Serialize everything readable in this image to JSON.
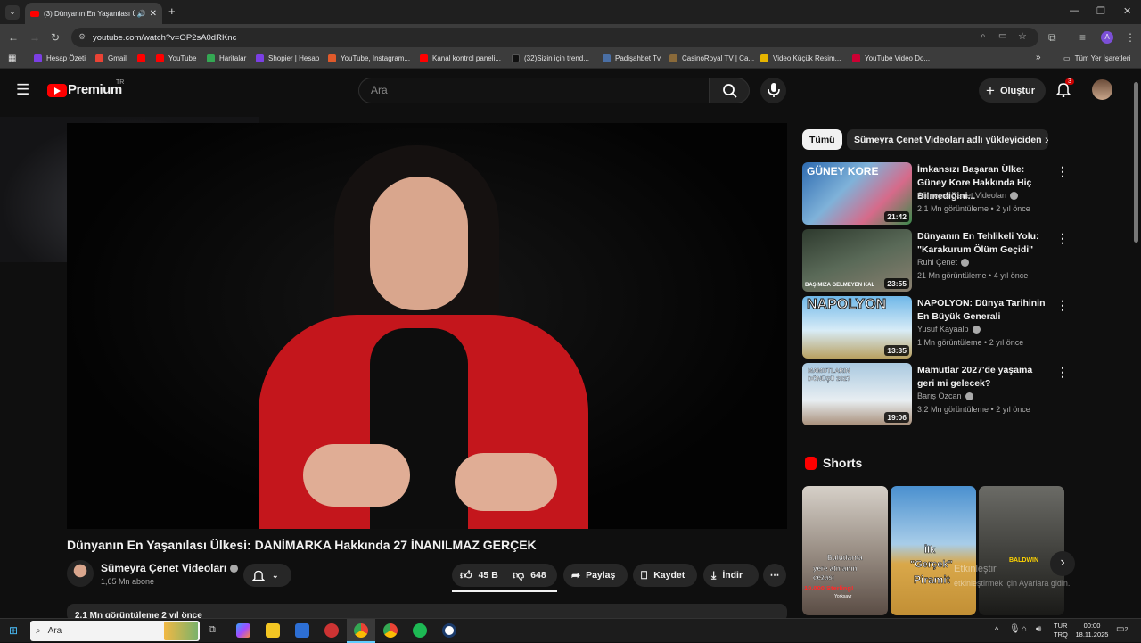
{
  "browser": {
    "tab_title": "(3) Dünyanın En Yaşanılası Ü",
    "url": "youtube.com/watch?v=OP2sA0dRKnc",
    "bookmarks": [
      {
        "label": "Hesap Özeti",
        "color": "#7b3fe4"
      },
      {
        "label": "Gmail",
        "color": "#ea4335"
      },
      {
        "label": "",
        "color": "#ff0000"
      },
      {
        "label": "YouTube",
        "color": "#ff0000"
      },
      {
        "label": "Haritalar",
        "color": "#34a853"
      },
      {
        "label": "Shopier | Hesap",
        "color": "#7b3fe4"
      },
      {
        "label": "YouTube, Instagram...",
        "color": "#e05a2b"
      },
      {
        "label": "Kanal kontrol paneli...",
        "color": "#ff0000"
      },
      {
        "label": "(32)Sizin için trend...",
        "color": "#111111"
      },
      {
        "label": "Padişahbet Tv",
        "color": "#4a6fa5"
      },
      {
        "label": "CasinoRoyal TV | Ca...",
        "color": "#8a6a3a"
      },
      {
        "label": "Video Küçük Resim...",
        "color": "#e5b400"
      },
      {
        "label": "YouTube Video Do...",
        "color": "#cc0033"
      }
    ],
    "all_bookmarks": "Tüm Yer İşaretleri"
  },
  "youtube": {
    "logo_text": "Premium",
    "logo_sup": "TR",
    "search_placeholder": "Ara",
    "create_label": "Oluştur",
    "notif_count": "3",
    "accent": "#ff0000"
  },
  "video": {
    "title": "Dünyanın En Yaşanılası Ülkesi: DANİMARKA Hakkında 27 İNANILMAZ GERÇEK",
    "channel": "Sümeyra Çenet Videoları",
    "subscribers": "1,65 Mn abone",
    "likes": "45 B",
    "dislikes": "648",
    "share": "Paylaş",
    "save": "Kaydet",
    "download": "İndir",
    "views_peek": "2,1 Mn görüntüleme  2 yıl önce"
  },
  "sidebar": {
    "chips": [
      "Tümü",
      "Sümeyra Çenet Videoları adlı yükleyiciden"
    ],
    "recommendations": [
      {
        "title": "İmkansızı Başaran Ülke: Güney Kore Hakkında Hiç Bilmediğini...",
        "channel": "Sümeyra Çenet Videoları",
        "meta": "2,1 Mn görüntüleme • 2 yıl önce",
        "duration": "21:42",
        "overlay": "GÜNEY KORE"
      },
      {
        "title": "Dünyanın En Tehlikeli Yolu: \"Karakurum Ölüm Geçidi\"",
        "channel": "Ruhi Çenet",
        "meta": "21 Mn görüntüleme • 4 yıl önce",
        "duration": "23:55",
        "overlay": "BAŞIMIZA GELMEYEN KAL"
      },
      {
        "title": "NAPOLYON: Dünya Tarihinin En Büyük Generali",
        "channel": "Yusuf Kayaalp",
        "meta": "1 Mn görüntüleme • 2 yıl önce",
        "duration": "13:35",
        "overlay": "NAPOLYON"
      },
      {
        "title": "Mamutlar 2027'de yaşama geri mi gelecek?",
        "channel": "Barış Özcan",
        "meta": "3,2 Mn görüntüleme • 2 yıl önce",
        "duration": "19:06",
        "overlay": "MAMUTLARIN DÖNÜŞÜ 2027"
      }
    ],
    "shorts_title": "Shorts",
    "shorts": [
      {
        "overlay_top": "Bulutlarda",
        "overlay_mid": "yere atmanın cezası",
        "overlay_bot": "10.000 Sterling!",
        "overlay_small": "Yorkşayr"
      },
      {
        "overlay_top": "İlk",
        "overlay_mid": "\"Gerçek\"",
        "overlay_bot": "Piramit"
      },
      {
        "overlay_top": "BALDWIN"
      }
    ],
    "watermark": "Etkinleştir",
    "watermark_sub": "etkinleştirmek için Ayarlara gidin."
  },
  "taskbar": {
    "search_label": "Ara",
    "lang_top": "TUR",
    "lang_bot": "TRQ",
    "time": "00:00",
    "date": "18.11.2025",
    "notif": "2"
  }
}
